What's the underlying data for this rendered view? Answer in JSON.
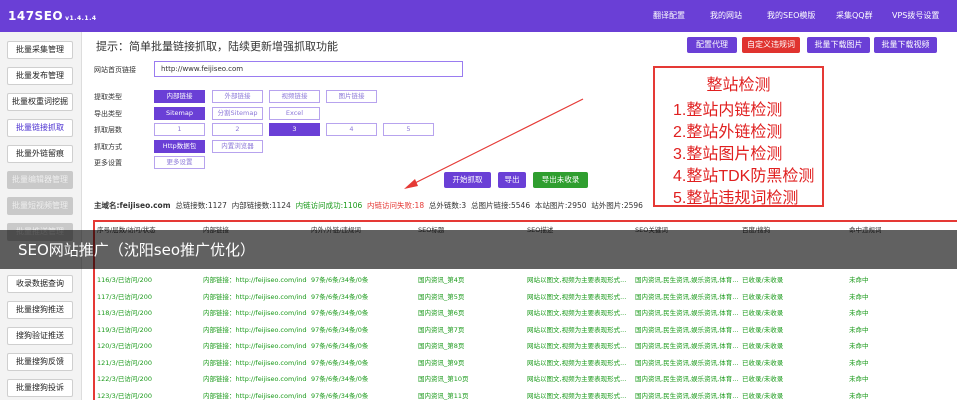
{
  "header": {
    "logo": "147SEO",
    "version": "v1.4.1.4",
    "nav": [
      "翻译配置",
      "我的网站",
      "我的SEO模版",
      "采集QQ群",
      "VPS拨号设置"
    ]
  },
  "sidebar": {
    "items": [
      {
        "label": "批量采集管理",
        "state": "normal"
      },
      {
        "label": "批量发布管理",
        "state": "normal"
      },
      {
        "label": "批量权重词挖掘",
        "state": "normal"
      },
      {
        "label": "批量链接抓取",
        "state": "active"
      },
      {
        "label": "批量外链留痕",
        "state": "normal"
      },
      {
        "label": "批量编辑器管理",
        "state": "disabled"
      },
      {
        "label": "批量短视频管理",
        "state": "disabled"
      },
      {
        "label": "批量推送管理",
        "state": "disabled"
      },
      {
        "label": "收录数据查询",
        "state": "normal"
      },
      {
        "label": "批量搜狗推送",
        "state": "normal"
      },
      {
        "label": "搜狗验证推送",
        "state": "normal"
      },
      {
        "label": "批量搜狗反馈",
        "state": "normal"
      },
      {
        "label": "批量搜狗投诉",
        "state": "normal"
      }
    ]
  },
  "main": {
    "tip": "提示：简单批量链接抓取，陆续更新增强抓取功能",
    "buttons": [
      "配置代理",
      "自定义违规词",
      "批量下载图片",
      "批量下载视频"
    ],
    "url_label": "网站首页链接",
    "url_value": "http://www.feijiseo.com",
    "options": [
      {
        "label": "提取类型",
        "choices": [
          "内部链接",
          "外部链接",
          "视频链接",
          "图片链接"
        ],
        "selected": 0
      },
      {
        "label": "导出类型",
        "choices": [
          "Sitemap",
          "分割Sitemap",
          "Excel"
        ],
        "selected": 0
      },
      {
        "label": "抓取层数",
        "choices": [
          "1",
          "2",
          "3",
          "4",
          "5"
        ],
        "selected": 2
      },
      {
        "label": "抓取方式",
        "choices": [
          "Http数据包",
          "内置浏览器"
        ],
        "selected": 0
      },
      {
        "label": "更多设置",
        "choices": [
          "更多设置"
        ],
        "selected": -1
      }
    ],
    "actions": [
      "开始抓取",
      "导出",
      "导出未收录"
    ],
    "colors": {
      "primary": "#6a3fd6",
      "green": "#2f9e2f",
      "red": "#e53935"
    }
  },
  "annotation": {
    "title": "整站检测",
    "items": [
      "1.整站内链检测",
      "2.整站外链检测",
      "3.整站图片检测",
      "4.整站TDK防黑检测",
      "5.整站违规词检测"
    ]
  },
  "stats": {
    "domain_label": "主域名:",
    "domain": "feijiseo.com",
    "total_links": "总链接数:1127",
    "internal_links": "内部链接数:1124",
    "success": "内链访问成功:1106",
    "failed": "内链访问失败:18",
    "external": "总外链数:3",
    "images": "总图片链接:5546",
    "site_images": "本站图片:2950",
    "offsite_images": "站外图片:2596"
  },
  "table": {
    "headers": [
      "序号/层数/访问/状态",
      "内部链接",
      "内外/外链/违规词",
      "SEO标题",
      "SEO描述",
      "SEO关键词",
      "百度/搜狗",
      "命中违规词"
    ],
    "rows": [
      [
        "116/3/已访问/200",
        "内部链接：http://feijiseo.com/index.ph",
        "97条/6条/34条/0条",
        "国内资讯_第4页",
        "网站以图文,视频为主要表现形式...",
        "国内资讯,民生资讯,娱乐资讯,体育...",
        "已收录/未收录",
        "未命中"
      ],
      [
        "117/3/已访问/200",
        "内部链接：http://feijiseo.com/index.ph",
        "97条/6条/34条/0条",
        "国内资讯_第5页",
        "网站以图文,视频为主要表现形式...",
        "国内资讯,民生资讯,娱乐资讯,体育...",
        "已收录/未收录",
        "未命中"
      ],
      [
        "118/3/已访问/200",
        "内部链接：http://feijiseo.com/index.ph",
        "97条/6条/34条/0条",
        "国内资讯_第6页",
        "网站以图文,视频为主要表现形式...",
        "国内资讯,民生资讯,娱乐资讯,体育...",
        "已收录/未收录",
        "未命中"
      ],
      [
        "119/3/已访问/200",
        "内部链接：http://feijiseo.com/index.ph",
        "97条/6条/34条/0条",
        "国内资讯_第7页",
        "网站以图文,视频为主要表现形式...",
        "国内资讯,民生资讯,娱乐资讯,体育...",
        "已收录/未收录",
        "未命中"
      ],
      [
        "120/3/已访问/200",
        "内部链接：http://feijiseo.com/index.ph",
        "97条/6条/34条/0条",
        "国内资讯_第8页",
        "网站以图文,视频为主要表现形式...",
        "国内资讯,民生资讯,娱乐资讯,体育...",
        "已收录/未收录",
        "未命中"
      ],
      [
        "121/3/已访问/200",
        "内部链接：http://feijiseo.com/index.ph",
        "97条/6条/34条/0条",
        "国内资讯_第9页",
        "网站以图文,视频为主要表现形式...",
        "国内资讯,民生资讯,娱乐资讯,体育...",
        "已收录/未收录",
        "未命中"
      ],
      [
        "122/3/已访问/200",
        "内部链接：http://feijiseo.com/index.ph",
        "97条/6条/34条/0条",
        "国内资讯_第10页",
        "网站以图文,视频为主要表现形式...",
        "国内资讯,民生资讯,娱乐资讯,体育...",
        "已收录/未收录",
        "未命中"
      ],
      [
        "123/3/已访问/200",
        "内部链接：http://feijiseo.com/index.ph",
        "97条/6条/34条/0条",
        "国内资讯_第11页",
        "网站以图文,视频为主要表现形式...",
        "国内资讯,民生资讯,娱乐资讯,体育...",
        "已收录/未收录",
        "未命中"
      ]
    ]
  },
  "overlay": {
    "text": "SEO网站推广（沈阳seo推广优化）"
  }
}
